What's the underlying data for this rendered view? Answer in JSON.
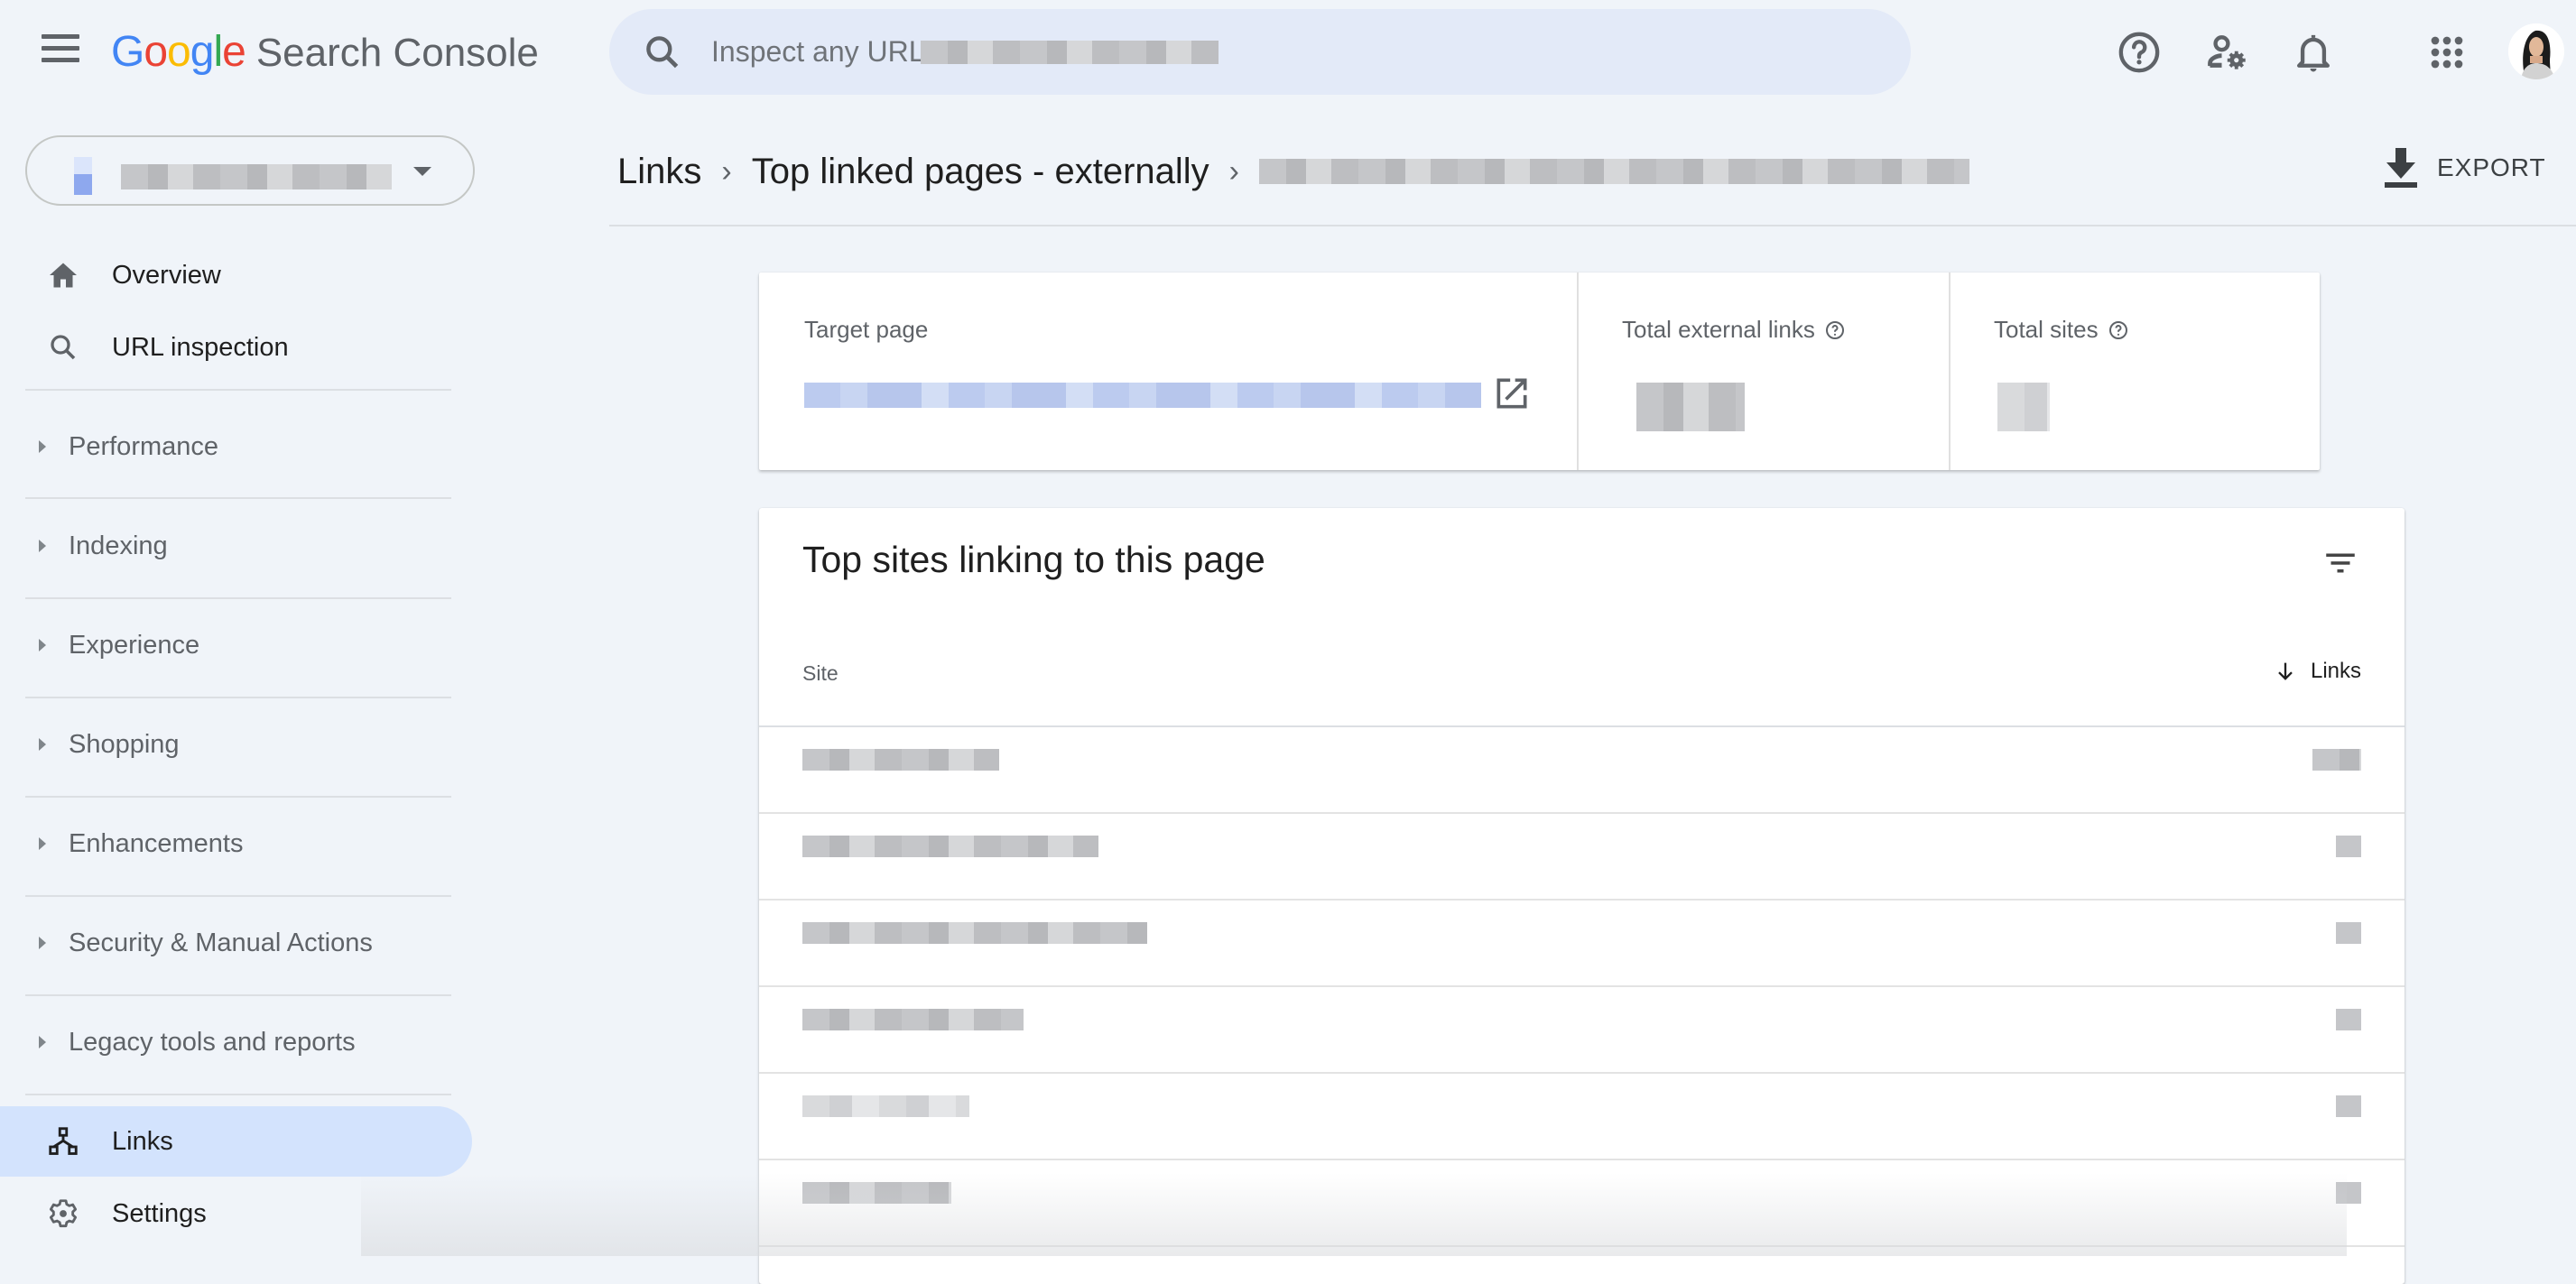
{
  "header": {
    "app_name_google": [
      "G",
      "o",
      "o",
      "g",
      "l",
      "e"
    ],
    "app_name_google_colors": [
      "#4285f4",
      "#ea4335",
      "#fbbc05",
      "#4285f4",
      "#34a853",
      "#ea4335"
    ],
    "app_name_product": "Search Console",
    "search_placeholder": "Inspect any URL",
    "search_value_redacted": true,
    "icons": [
      "menu-icon",
      "search-icon",
      "help-icon",
      "manage-users-icon",
      "notifications-icon",
      "apps-icon",
      "avatar"
    ]
  },
  "property_selector": {
    "value_redacted": true
  },
  "sidebar": {
    "top_items": [
      {
        "label": "Overview",
        "icon": "home-icon"
      },
      {
        "label": "URL inspection",
        "icon": "search-icon"
      }
    ],
    "sections": [
      {
        "label": "Performance"
      },
      {
        "label": "Indexing"
      },
      {
        "label": "Experience"
      },
      {
        "label": "Shopping"
      },
      {
        "label": "Enhancements"
      },
      {
        "label": "Security & Manual Actions"
      },
      {
        "label": "Legacy tools and reports"
      }
    ],
    "bottom_items": [
      {
        "label": "Links",
        "icon": "links-icon",
        "active": true
      },
      {
        "label": "Settings",
        "icon": "settings-icon"
      }
    ]
  },
  "breadcrumb": {
    "items": [
      "Links",
      "Top linked pages - externally"
    ],
    "last_item_redacted": true
  },
  "toolbar": {
    "export_label": "EXPORT"
  },
  "summary": {
    "target_page_label": "Target page",
    "target_page_value_redacted": true,
    "total_external_links_label": "Total external links",
    "total_external_links_value_redacted": true,
    "total_sites_label": "Total sites",
    "total_sites_value_redacted": true
  },
  "table": {
    "title": "Top sites linking to this page",
    "columns": [
      {
        "label": "Site"
      },
      {
        "label": "Links",
        "sort": "descending"
      }
    ],
    "rows": [
      {
        "site": "[redacted]",
        "links": "[redacted]"
      },
      {
        "site": "[redacted]",
        "links": "[redacted]"
      },
      {
        "site": "[redacted]",
        "links": "[redacted]"
      },
      {
        "site": "[redacted]",
        "links": "[redacted]"
      },
      {
        "site": "[redacted]",
        "links": "[redacted]"
      },
      {
        "site": "[redacted]",
        "links": "[redacted]"
      }
    ]
  },
  "colors": {
    "background": "#f0f4f9",
    "search_bg": "#e3eaf8",
    "active_nav_bg": "#d3e3fd",
    "text_primary": "#1f1f1f",
    "text_secondary": "#5f6368"
  }
}
